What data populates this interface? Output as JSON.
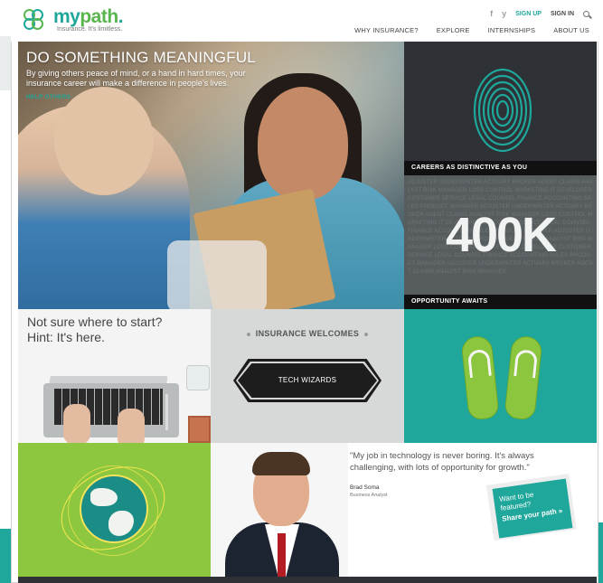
{
  "header": {
    "logo_name_1": "my",
    "logo_name_2": "path",
    "logo_mark": ".",
    "logo_tagline": "Insurance. It's limitless.",
    "facebook_icon": "f",
    "twitter_icon": "y",
    "signup": "SIGN UP",
    "signin": "SIGN IN",
    "nav": [
      "WHY INSURANCE?",
      "EXPLORE",
      "INTERNSHIPS",
      "ABOUT US"
    ]
  },
  "hero": {
    "title": "DO SOMETHING MEANINGFUL",
    "subtitle": "By giving others peace of mind, or a hand in hard times, your insurance career will make a difference in people's lives.",
    "link": "HELP OTHERS"
  },
  "tiles": {
    "careers_caption": "CAREERS AS DISTINCTIVE AS YOU",
    "big_number": "400K",
    "opportunity_caption": "OPPORTUNITY AWAITS",
    "start_line1": "Not sure where to start?",
    "start_line2": "Hint: It's here.",
    "welcomes_title": "INSURANCE WELCOMES",
    "welcomes_button": "TECH WIZARDS"
  },
  "quote": {
    "text": "\"My job in technology is never boring. It's always challenging, with lots of opportunity for growth.\"",
    "name": "Brad Soma",
    "role": "Business Analyst",
    "feature_question": "Want to be featured?",
    "feature_link": "Share your path »"
  },
  "colors": {
    "brand_teal": "#1ea79a",
    "brand_green": "#8dc63f",
    "dark_tile": "#2e3135"
  }
}
